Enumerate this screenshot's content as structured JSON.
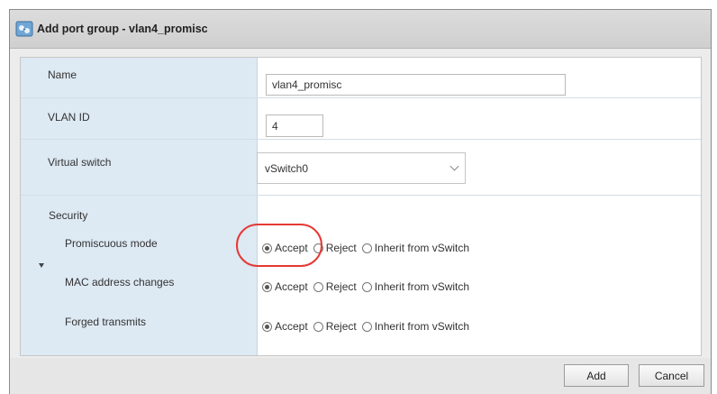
{
  "dialog": {
    "title": "Add port group - vlan4_promisc"
  },
  "form": {
    "name": {
      "label": "Name",
      "value": "vlan4_promisc"
    },
    "vlan_id": {
      "label": "VLAN ID",
      "value": "4"
    },
    "virtual_switch": {
      "label": "Virtual switch",
      "selected": "vSwitch0"
    },
    "security": {
      "label": "Security",
      "rows": [
        {
          "label": "Promiscuous mode",
          "selected": "Accept"
        },
        {
          "label": "MAC address changes",
          "selected": "Accept"
        },
        {
          "label": "Forged transmits",
          "selected": "Accept"
        }
      ],
      "options": {
        "accept": "Accept",
        "reject": "Reject",
        "inherit": "Inherit from vSwitch"
      }
    }
  },
  "buttons": {
    "add": "Add",
    "cancel": "Cancel"
  },
  "colors": {
    "highlight": "#e53935",
    "label_column": "#dde9f3"
  }
}
